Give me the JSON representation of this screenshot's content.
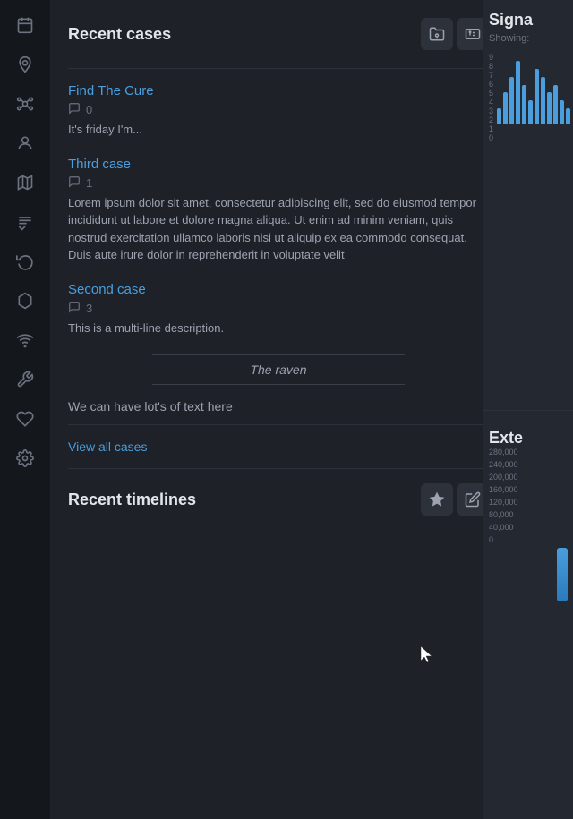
{
  "sidebar": {
    "items": [
      {
        "icon": "🗓",
        "name": "calendar-icon"
      },
      {
        "icon": "📍",
        "name": "location-icon"
      },
      {
        "icon": "⚙",
        "name": "network-icon"
      },
      {
        "icon": "👤",
        "name": "person-icon"
      },
      {
        "icon": "🗺",
        "name": "map-icon"
      },
      {
        "icon": "☰",
        "name": "list-icon"
      },
      {
        "icon": "↩",
        "name": "refresh-icon"
      },
      {
        "icon": "⬡",
        "name": "hex-icon"
      },
      {
        "icon": "📡",
        "name": "signal-icon"
      },
      {
        "icon": "🔧",
        "name": "tools-icon"
      },
      {
        "icon": "♡",
        "name": "heart-icon"
      },
      {
        "icon": "⚙",
        "name": "gear-icon"
      }
    ]
  },
  "recent_cases": {
    "title": "Recent cases",
    "header_icon1": "📁",
    "header_icon2": "🆔",
    "cases": [
      {
        "title": "Find The Cure",
        "comments": 0,
        "description": "It's friday I'm..."
      },
      {
        "title": "Third case",
        "comments": 1,
        "description": "Lorem ipsum dolor sit amet, consectetur adipiscing elit, sed do eiusmod tempor incididunt ut labore et dolore magna aliqua. Ut enim ad minim veniam, quis nostrud exercitation ullamco laboris nisi ut aliquip ex ea commodo consequat. Duis aute irure dolor in reprehenderit in voluptate velit"
      },
      {
        "title": "Second case",
        "comments": 3,
        "description": "This is a multi-line description."
      }
    ],
    "raven_text": "The raven",
    "footer_text": "We can have lot's of text here",
    "view_all_label": "View all cases"
  },
  "recent_timelines": {
    "title": "Recent timelines",
    "header_icon1": "⭐",
    "header_icon2": "✏"
  },
  "right_panel": {
    "signature": {
      "title": "Signa",
      "subtitle": "Showing:",
      "y_labels": [
        "9",
        "8",
        "7",
        "6",
        "5",
        "4",
        "3",
        "2",
        "1",
        "0"
      ],
      "bars": [
        2,
        4,
        6,
        8,
        5,
        3,
        7,
        6,
        4,
        5,
        3,
        2
      ]
    },
    "external": {
      "title": "Exte",
      "values": [
        "280,000",
        "240,000",
        "200,000",
        "160,000",
        "120,000",
        "80,000",
        "40,000",
        "0"
      ]
    }
  }
}
